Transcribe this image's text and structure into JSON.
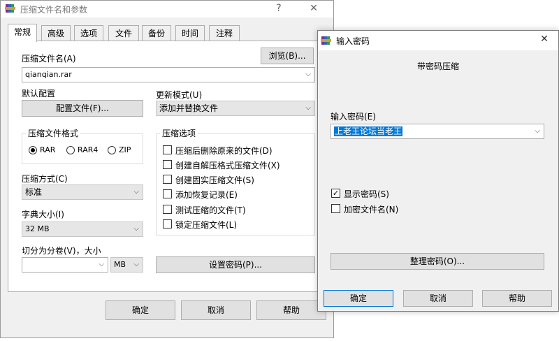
{
  "main": {
    "title": "压缩文件名和参数",
    "help_glyph": "?",
    "close_glyph": "✕",
    "tabs": [
      {
        "label": "常规"
      },
      {
        "label": "高级"
      },
      {
        "label": "选项"
      },
      {
        "label": "文件"
      },
      {
        "label": "备份"
      },
      {
        "label": "时间"
      },
      {
        "label": "注释"
      }
    ],
    "archive_name_label": "压缩文件名(A)",
    "browse_label": "浏览(B)...",
    "archive_name_value": "qianqian.rar",
    "default_profile_label": "默认配置",
    "profile_button": "配置文件(F)...",
    "update_mode_label": "更新模式(U)",
    "update_mode_value": "添加并替换文件",
    "format_group_label": "压缩文件格式",
    "formats": [
      {
        "label": "RAR",
        "selected": true
      },
      {
        "label": "RAR4",
        "selected": false
      },
      {
        "label": "ZIP",
        "selected": false
      }
    ],
    "options_group_label": "压缩选项",
    "options": [
      {
        "label": "压缩后删除原来的文件(D)",
        "checked": false
      },
      {
        "label": "创建自解压格式压缩文件(X)",
        "checked": false
      },
      {
        "label": "创建固实压缩文件(S)",
        "checked": false
      },
      {
        "label": "添加恢复记录(E)",
        "checked": false
      },
      {
        "label": "测试压缩的文件(T)",
        "checked": false
      },
      {
        "label": "锁定压缩文件(L)",
        "checked": false
      }
    ],
    "method_label": "压缩方式(C)",
    "method_value": "标准",
    "dict_label": "字典大小(I)",
    "dict_value": "32 MB",
    "split_label": "切分为分卷(V)，大小",
    "split_value": "",
    "split_unit": "MB",
    "set_password_button": "设置密码(P)...",
    "ok_button": "确定",
    "cancel_button": "取消",
    "help_button": "帮助"
  },
  "password_dialog": {
    "title": "输入密码",
    "close_glyph": "✕",
    "heading": "带密码压缩",
    "password_label": "输入密码(E)",
    "password_value": "上老王论坛当老王",
    "show_password_label": "显示密码(S)",
    "show_password_checked": true,
    "encrypt_names_label": "加密文件名(N)",
    "encrypt_names_checked": false,
    "organize_button": "整理密码(O)...",
    "ok_button": "确定",
    "cancel_button": "取消",
    "help_button": "帮助"
  },
  "icons": {
    "app": "winrar-books-icon",
    "dropdown": "chevron-down-icon",
    "check_glyph": "✓",
    "chevron_glyph": "⌵"
  },
  "colors": {
    "selection": "#0078d7",
    "dialog_bg": "#f0f0f0",
    "button_bg": "#e1e1e1"
  }
}
